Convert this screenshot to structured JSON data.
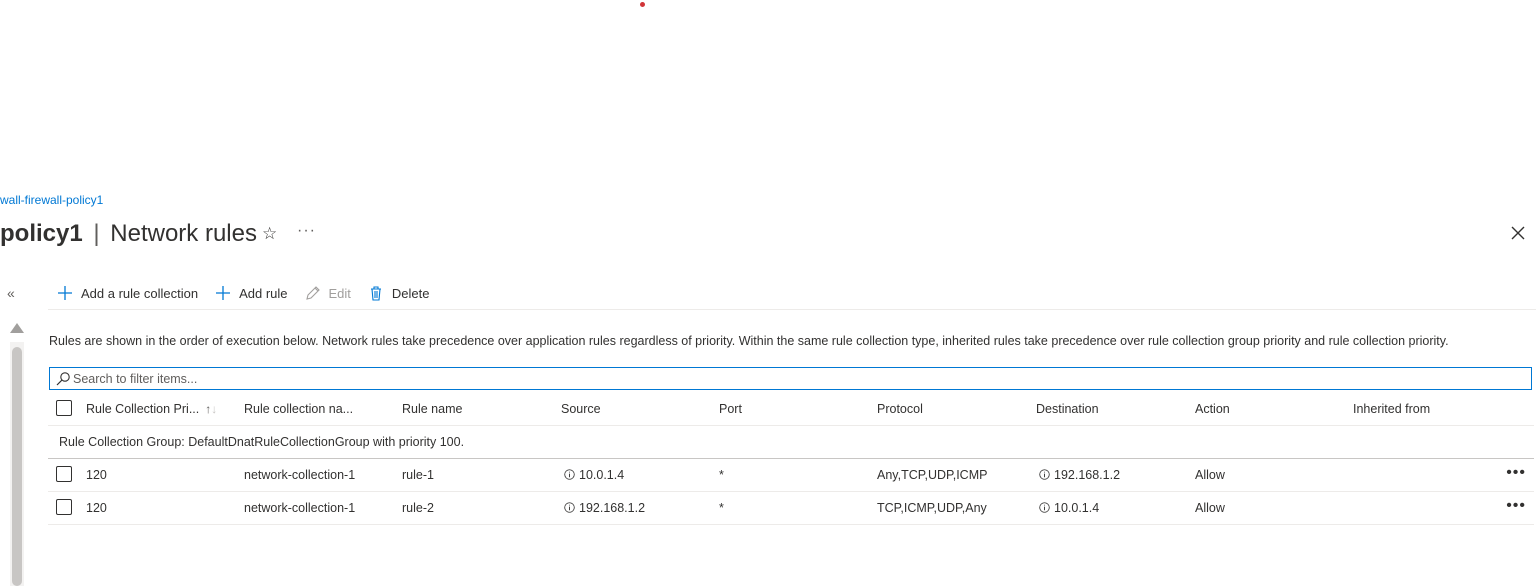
{
  "breadcrumb": "wall-firewall-policy1",
  "title": {
    "bold": "policy1",
    "separator": "|",
    "rest": "Network rules"
  },
  "toolbar": {
    "add_collection": "Add a rule collection",
    "add_rule": "Add rule",
    "edit": "Edit",
    "delete": "Delete"
  },
  "info_text": "Rules are shown in the order of execution below. Network rules take precedence over application rules regardless of priority. Within the same rule collection type, inherited rules take precedence over rule collection group priority and rule collection priority.",
  "search": {
    "placeholder": "Search to filter items..."
  },
  "columns": {
    "priority": "Rule Collection Pri...",
    "collection_name": "Rule collection na...",
    "rule_name": "Rule name",
    "source": "Source",
    "port": "Port",
    "protocol": "Protocol",
    "destination": "Destination",
    "action": "Action",
    "inherited": "Inherited from"
  },
  "group_label": "Rule Collection Group: DefaultDnatRuleCollectionGroup with priority 100.",
  "rows": [
    {
      "priority": "120",
      "collection": "network-collection-1",
      "rule": "rule-1",
      "source": "10.0.1.4",
      "port": "*",
      "protocol": "Any,TCP,UDP,ICMP",
      "destination": "192.168.1.2",
      "action": "Allow",
      "inherited": ""
    },
    {
      "priority": "120",
      "collection": "network-collection-1",
      "rule": "rule-2",
      "source": "192.168.1.2",
      "port": "*",
      "protocol": "TCP,ICMP,UDP,Any",
      "destination": "10.0.1.4",
      "action": "Allow",
      "inherited": ""
    }
  ],
  "icons": {
    "star": "star-icon",
    "more": "more-icon",
    "close": "close-icon",
    "collapse": "double-chevron-left-icon",
    "add": "plus-icon",
    "edit": "pencil-icon",
    "delete": "trash-icon",
    "search": "search-icon",
    "info": "info-icon"
  },
  "colors": {
    "accent": "#0078d4",
    "text": "#323130",
    "disabled": "#a19f9d"
  }
}
